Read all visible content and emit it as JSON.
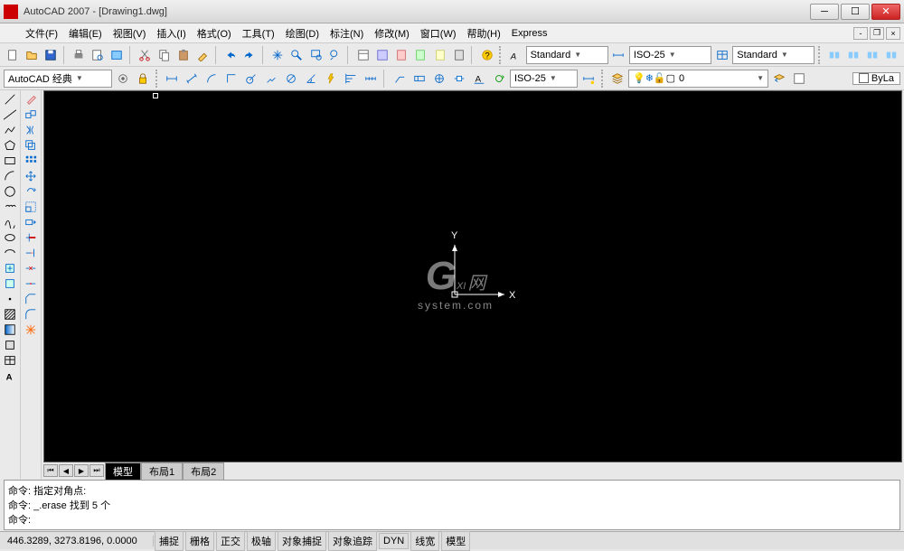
{
  "title": "AutoCAD 2007 - [Drawing1.dwg]",
  "menus": [
    "文件(F)",
    "编辑(E)",
    "视图(V)",
    "插入(I)",
    "格式(O)",
    "工具(T)",
    "绘图(D)",
    "标注(N)",
    "修改(M)",
    "窗口(W)",
    "帮助(H)",
    "Express"
  ],
  "toolbar1": {
    "text_style": "Standard",
    "dim_style1": "ISO-25",
    "table_style": "Standard"
  },
  "toolbar2": {
    "workspace": "AutoCAD 经典",
    "dim_style2": "ISO-25",
    "layer_current": "0",
    "bylayer": "ByLa"
  },
  "layout_tabs": {
    "active": "模型",
    "others": [
      "布局1",
      "布局2"
    ]
  },
  "command_history": [
    "命令: 指定对角点:",
    "命令: _.erase 找到 5 个",
    "命令:"
  ],
  "status": {
    "coords": "446.3289, 3273.8196, 0.0000",
    "buttons": [
      "捕捉",
      "栅格",
      "正交",
      "极轴",
      "对象捕捉",
      "对象追踪",
      "DYN",
      "线宽",
      "模型"
    ]
  },
  "ucs": {
    "x_label": "X",
    "y_label": "Y"
  },
  "watermark": {
    "brand_g": "G",
    "brand_xi": "XI",
    "brand_net": "网",
    "sys": "system.com"
  },
  "colors": {
    "canvas_bg": "#000000",
    "ui_bg": "#eaeaea"
  }
}
